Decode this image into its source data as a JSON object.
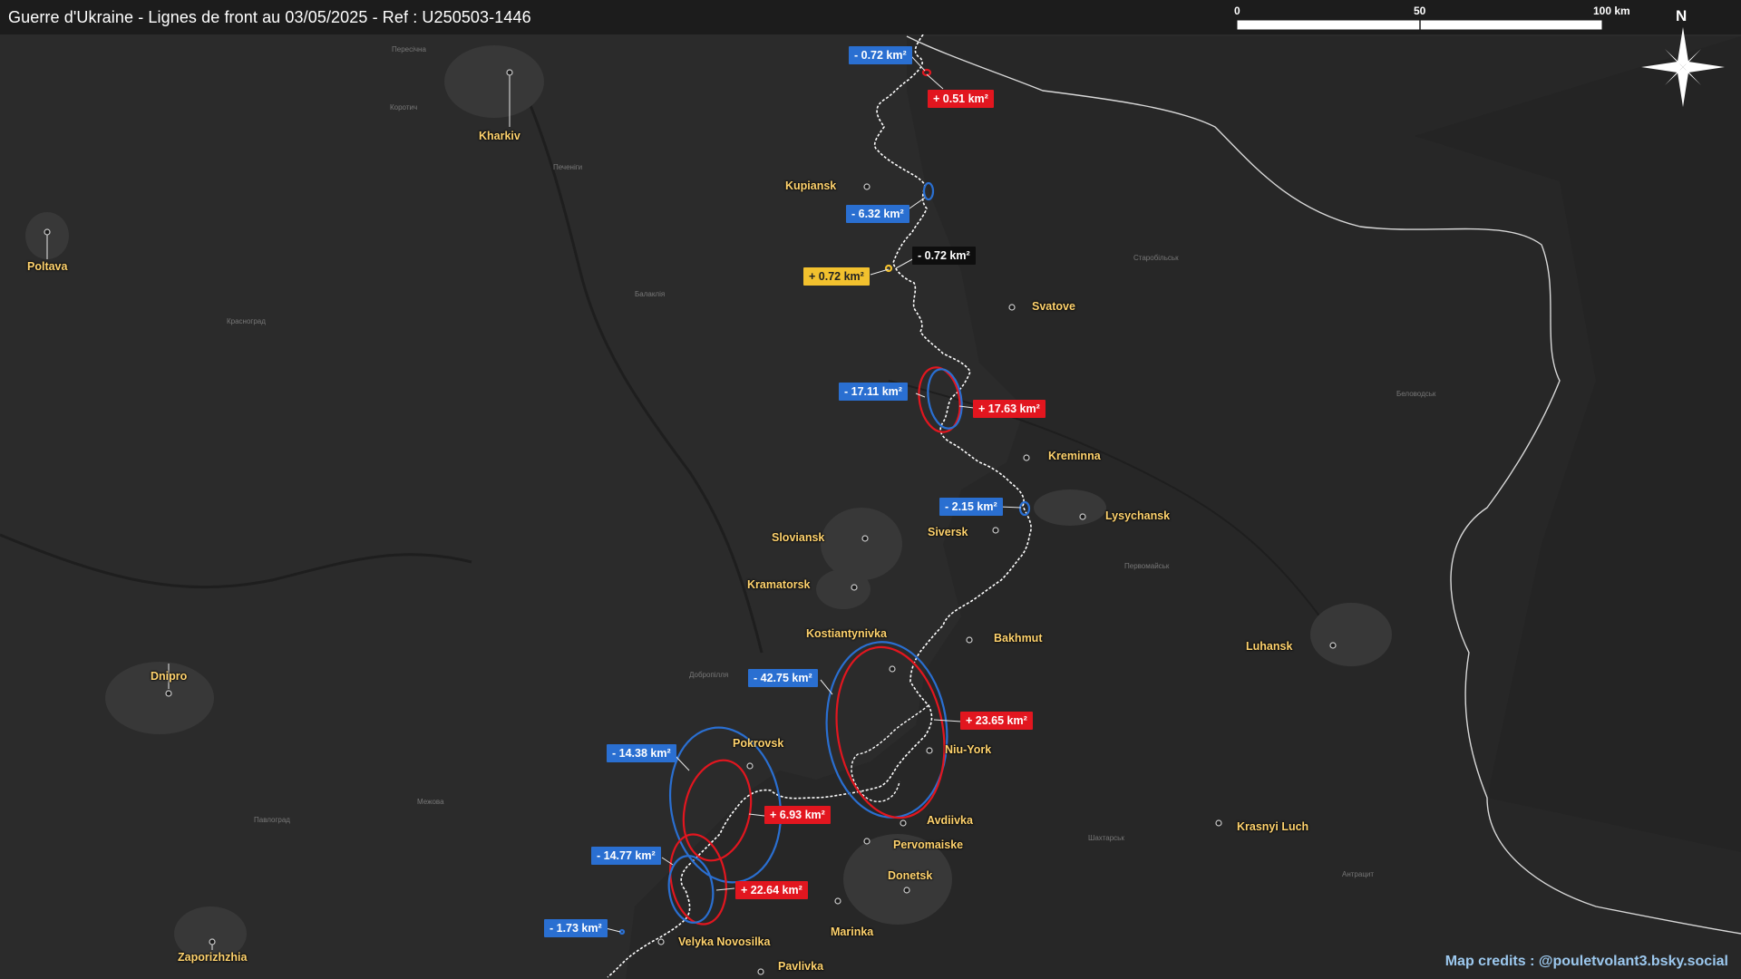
{
  "header": {
    "title": "Guerre d'Ukraine - Lignes de front au 03/05/2025 - Ref : U250503-1446"
  },
  "scale_bar": {
    "labels": [
      "0",
      "50",
      "100 km"
    ]
  },
  "north_arrow": {
    "label": "N"
  },
  "credits": "Map credits : @pouletvolant3.bsky.social",
  "cities": [
    {
      "name": "Kharkiv"
    },
    {
      "name": "Poltava"
    },
    {
      "name": "Kupiansk"
    },
    {
      "name": "Svatove"
    },
    {
      "name": "Kreminna"
    },
    {
      "name": "Lysychansk"
    },
    {
      "name": "Siversk"
    },
    {
      "name": "Sloviansk"
    },
    {
      "name": "Kramatorsk"
    },
    {
      "name": "Kostiantynivka"
    },
    {
      "name": "Bakhmut"
    },
    {
      "name": "Luhansk"
    },
    {
      "name": "Dnipro"
    },
    {
      "name": "Pokrovsk"
    },
    {
      "name": "Niu-York"
    },
    {
      "name": "Avdiivka"
    },
    {
      "name": "Pervomaiske"
    },
    {
      "name": "Krasnyi Luch"
    },
    {
      "name": "Donetsk"
    },
    {
      "name": "Marinka"
    },
    {
      "name": "Velyka Novosilka"
    },
    {
      "name": "Pavlivka"
    },
    {
      "name": "Zaporizhzhia"
    }
  ],
  "changes": [
    {
      "text": "- 0.72 km²",
      "kind": "blue"
    },
    {
      "text": "+ 0.51 km²",
      "kind": "red"
    },
    {
      "text": "- 6.32 km²",
      "kind": "blue"
    },
    {
      "text": "- 0.72 km²",
      "kind": "black"
    },
    {
      "text": "+ 0.72 km²",
      "kind": "yellow"
    },
    {
      "text": "- 17.11 km²",
      "kind": "blue"
    },
    {
      "text": "+ 17.63 km²",
      "kind": "red"
    },
    {
      "text": "- 2.15 km²",
      "kind": "blue"
    },
    {
      "text": "- 42.75 km²",
      "kind": "blue"
    },
    {
      "text": "+ 23.65 km²",
      "kind": "red"
    },
    {
      "text": "- 14.38 km²",
      "kind": "blue"
    },
    {
      "text": "+ 6.93 km²",
      "kind": "red"
    },
    {
      "text": "- 14.77 km²",
      "kind": "blue"
    },
    {
      "text": "+ 22.64 km²",
      "kind": "red"
    },
    {
      "text": "- 1.73 km²",
      "kind": "blue"
    }
  ],
  "colors": {
    "background": "#2a2a2a",
    "city_label": "#ffd36e",
    "gain_blue": "#2a6fd1",
    "gain_red": "#e2161f",
    "front_line": "#ffffff"
  }
}
